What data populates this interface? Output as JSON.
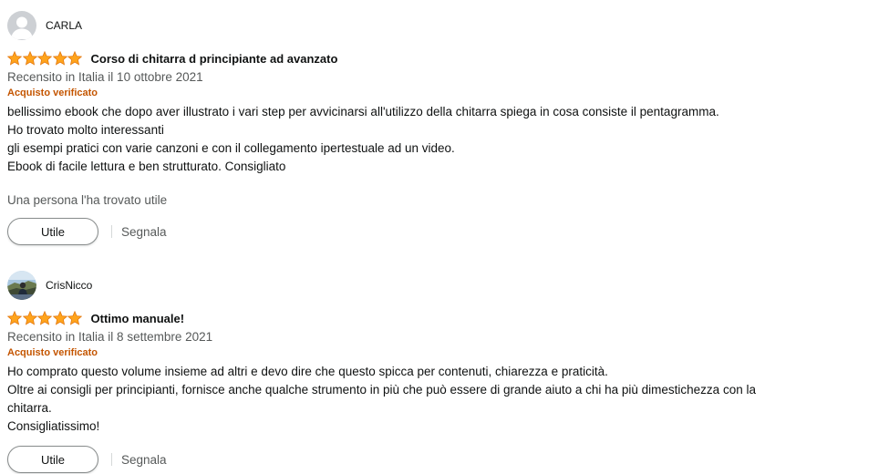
{
  "reviews": [
    {
      "profile_name": "CARLA",
      "avatar": "default-user-icon",
      "rating": 5,
      "title": "Corso di chitarra d principiante ad avanzato",
      "date": "Recensito in Italia il 10 ottobre 2021",
      "verified": "Acquisto verificato",
      "body": [
        "bellissimo ebook che dopo aver illustrato i vari step per avvicinarsi all'utilizzo della chitarra spiega in cosa consiste il pentagramma.",
        "Ho trovato molto interessanti",
        "gli esempi pratici con varie canzoni e con il collegamento ipertestuale ad un video.",
        "Ebook di facile lettura e ben strutturato. Consigliato"
      ],
      "helpful_text": "Una persona l'ha trovato utile",
      "helpful_button": "Utile",
      "report_link": "Segnala"
    },
    {
      "profile_name": "CrisNicco",
      "avatar": "user-photo-avatar",
      "rating": 5,
      "title": "Ottimo manuale!",
      "date": "Recensito in Italia il 8 settembre 2021",
      "verified": "Acquisto verificato",
      "body": [
        "Ho comprato questo volume insieme ad altri e devo dire che questo spicca per contenuti, chiarezza e praticità.",
        "Oltre ai consigli per principianti, fornisce anche qualche strumento in più che può essere di grande aiuto a chi ha più dimestichezza con la",
        "chitarra.",
        "Consigliatissimo!"
      ],
      "helpful_button": "Utile",
      "report_link": "Segnala"
    }
  ],
  "colors": {
    "star": "#ffa41c",
    "star_outline": "#e47911",
    "verified": "#c45500",
    "secondary_text": "#565959"
  }
}
